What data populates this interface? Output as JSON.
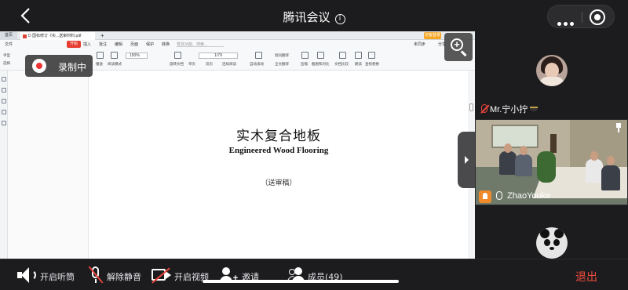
{
  "topbar": {
    "title": "腾讯会议",
    "info_glyph": "i"
  },
  "recording": {
    "label": "录制中"
  },
  "wps": {
    "home_tab": "首页",
    "doc_tab": "D 国标修订《实...送审材料.pdf",
    "login": "访客登录",
    "menu": [
      "文件",
      "开始",
      "插入",
      "批注",
      "编辑",
      "页面",
      "保护",
      "转换"
    ],
    "search": "查找功能、搜索...",
    "right_tools": [
      "未同步",
      "分享"
    ],
    "zoom": "150%",
    "page": "1/79",
    "toolbar_labels": [
      "手型",
      "选择",
      "播放",
      "阅读模式",
      "旋转文档",
      "单页",
      "双页",
      "连续阅读",
      "自动滚动",
      "划词翻译",
      "全文翻译",
      "压缩",
      "截图和对比",
      "文档比较",
      "朗读",
      "查找替换"
    ]
  },
  "document": {
    "title_cn": "实木复合地板",
    "title_en": "Engineered Wood Flooring",
    "note": "（送审稿）"
  },
  "participants": [
    {
      "name": "Mr.宁小拧",
      "muted": true
    },
    {
      "name": "ZhaoYouke",
      "speaking": true
    }
  ],
  "bottombar": {
    "speaker": "开启听筒",
    "unmute": "解除静音",
    "video": "开启视频",
    "invite": "邀请",
    "members": "成员(49)",
    "exit": "退出"
  },
  "colors": {
    "exit": "#ef4a3c",
    "muted": "#e5453b",
    "recording": "#e33333"
  }
}
